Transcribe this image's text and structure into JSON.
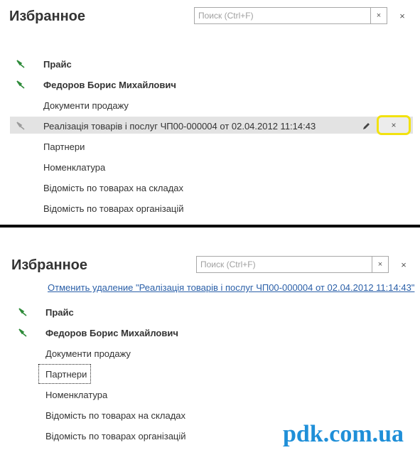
{
  "top": {
    "title": "Избранное",
    "search_placeholder": "Поиск (Ctrl+F)",
    "clear_glyph": "×",
    "close_glyph": "×",
    "items": [
      {
        "label": "Прайс",
        "bold": true,
        "pinned": true
      },
      {
        "label": "Федоров Борис Михайлович",
        "bold": true,
        "pinned": true
      },
      {
        "label": "Документи продажу",
        "bold": false,
        "pinned": false
      },
      {
        "label": "Реалізація товарів і послуг ЧП00-000004 от 02.04.2012 11:14:43",
        "bold": false,
        "pinned": true,
        "selected": true
      },
      {
        "label": "Партнери",
        "bold": false,
        "pinned": false
      },
      {
        "label": "Номенклатура",
        "bold": false,
        "pinned": false
      },
      {
        "label": "Відомість по товарах на складах",
        "bold": false,
        "pinned": false
      },
      {
        "label": "Відомість по товарах організацій",
        "bold": false,
        "pinned": false
      }
    ],
    "remove_glyph": "×"
  },
  "bottom": {
    "title": "Избранное",
    "search_placeholder": "Поиск (Ctrl+F)",
    "clear_glyph": "×",
    "close_glyph": "×",
    "undo_link": "Отменить удаление \"Реалізація товарів і послуг ЧП00-000004 от 02.04.2012 11:14:43\"",
    "items": [
      {
        "label": "Прайс",
        "bold": true,
        "pinned": true
      },
      {
        "label": "Федоров Борис Михайлович",
        "bold": true,
        "pinned": true
      },
      {
        "label": "Документи продажу",
        "bold": false,
        "pinned": false
      },
      {
        "label": "Партнери",
        "bold": false,
        "pinned": false,
        "focused": true
      },
      {
        "label": "Номенклатура",
        "bold": false,
        "pinned": false
      },
      {
        "label": "Відомість по товарах на складах",
        "bold": false,
        "pinned": false
      },
      {
        "label": "Відомість по товарах організацій",
        "bold": false,
        "pinned": false
      }
    ]
  },
  "watermark": "pdk.com.ua",
  "colors": {
    "pin_active": "#2e8b3a",
    "pin_inactive": "#9a9a9a",
    "link": "#2a5fa8",
    "highlight": "#f2e20f",
    "watermark": "#1f8fd8"
  }
}
